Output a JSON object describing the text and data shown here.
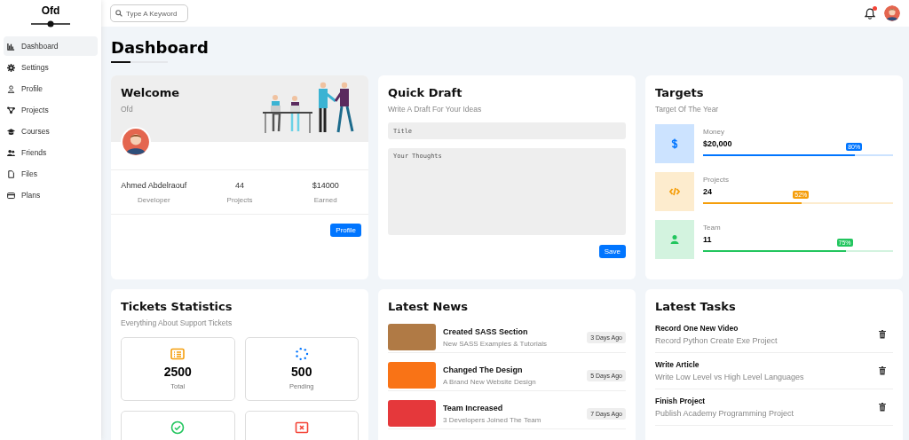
{
  "sidebar": {
    "brand": "Ofd",
    "items": [
      {
        "label": "Dashboard",
        "selected": true
      },
      {
        "label": "Settings",
        "selected": false
      },
      {
        "label": "Profile",
        "selected": false
      },
      {
        "label": "Projects",
        "selected": false
      },
      {
        "label": "Courses",
        "selected": false
      },
      {
        "label": "Friends",
        "selected": false
      },
      {
        "label": "Files",
        "selected": false
      },
      {
        "label": "Plans",
        "selected": false
      }
    ]
  },
  "header": {
    "search": {
      "placeholder": "Type A Keyword"
    },
    "notification": true
  },
  "page_title": "Dashboard",
  "welcome": {
    "title": "Welcome",
    "subtitle": "Ofd",
    "stats": [
      {
        "value": "Ahmed Abdelraouf",
        "label": "Developer"
      },
      {
        "value": "44",
        "label": "Projects"
      },
      {
        "value": "$14000",
        "label": "Earned"
      }
    ],
    "button": "Profile"
  },
  "quick_draft": {
    "title": "Quick Draft",
    "subtitle": "Write A Draft For Your Ideas",
    "title_field": {
      "placeholder": "Title"
    },
    "body_field": {
      "placeholder": "Your Thoughts"
    },
    "button": "Save"
  },
  "targets": {
    "title": "Targets",
    "subtitle": "Target Of The Year",
    "items": [
      {
        "label": "Money",
        "value": "$20,000",
        "level": 0.8,
        "reading": "80%",
        "color": "#0075ff"
      },
      {
        "label": "Projects",
        "value": "24",
        "level": 0.52,
        "reading": "52%",
        "color": "#f59e0b"
      },
      {
        "label": "Team",
        "value": "11",
        "level": 0.75,
        "reading": "75%",
        "color": "#22c55e"
      }
    ]
  },
  "tickets": {
    "title": "Tickets Statistics",
    "subtitle": "Everything About Support Tickets",
    "items": [
      {
        "kind": "list",
        "value": "2500",
        "label": "Total"
      },
      {
        "kind": "spinner",
        "value": "500",
        "label": "Pending"
      },
      {
        "kind": "check"
      },
      {
        "kind": "cross"
      }
    ]
  },
  "news": {
    "title": "Latest News",
    "items": [
      {
        "title": "Created SASS Section",
        "text": "New SASS Examples & Tutorials",
        "time": "3 Days Ago"
      },
      {
        "title": "Changed The Design",
        "text": "A Brand New Website Design",
        "time": "5 Days Ago"
      },
      {
        "title": "Team Increased",
        "text": "3 Developers Joined The Team",
        "time": "7 Days Ago"
      }
    ]
  },
  "tasks": {
    "title": "Latest Tasks",
    "items": [
      {
        "title": "Record One New Video",
        "text": "Record Python Create Exe Project"
      },
      {
        "title": "Write Article",
        "text": "Write Low Level vs High Level Languages"
      },
      {
        "title": "Finish Project",
        "text": "Publish Academy Programming Project"
      }
    ]
  }
}
